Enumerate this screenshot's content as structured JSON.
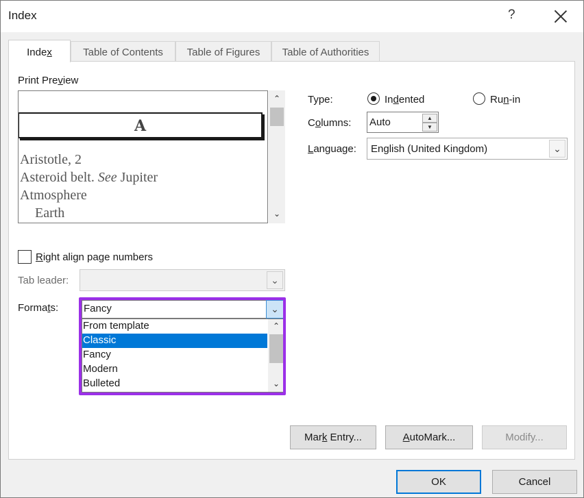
{
  "window": {
    "title": "Index",
    "help_label": "?"
  },
  "tabs": [
    {
      "label": "Index",
      "active": true
    },
    {
      "label": "Table of Contents",
      "active": false
    },
    {
      "label": "Table of Figures",
      "active": false
    },
    {
      "label": "Table of Authorities",
      "active": false
    }
  ],
  "preview": {
    "label": "Print Preview",
    "heading_letter": "A",
    "entries": [
      {
        "text": "Aristotle, 2"
      },
      {
        "text_before": "Asteroid belt. ",
        "italic": "See",
        "text_after": " Jupiter"
      },
      {
        "text": "Atmosphere"
      },
      {
        "text": "Earth"
      }
    ]
  },
  "type": {
    "label": "Type:",
    "options": [
      {
        "label": "Indented",
        "selected": true
      },
      {
        "label": "Run-in",
        "selected": false
      }
    ]
  },
  "columns": {
    "label": "Columns:",
    "value": "Auto"
  },
  "language": {
    "label": "Language:",
    "value": "English (United Kingdom)"
  },
  "right_align": {
    "label": "Right align page numbers",
    "checked": false
  },
  "tab_leader": {
    "label": "Tab leader:",
    "value": ""
  },
  "formats": {
    "label": "Formats:",
    "value": "Fancy",
    "options": [
      "From template",
      "Classic",
      "Fancy",
      "Modern",
      "Bulleted"
    ],
    "highlighted": "Classic"
  },
  "buttons": {
    "mark_entry": "Mark Entry...",
    "automark": "AutoMark...",
    "modify": "Modify...",
    "ok": "OK",
    "cancel": "Cancel"
  },
  "colors": {
    "highlight_outline": "#9b30e8",
    "selection": "#0078d7"
  }
}
